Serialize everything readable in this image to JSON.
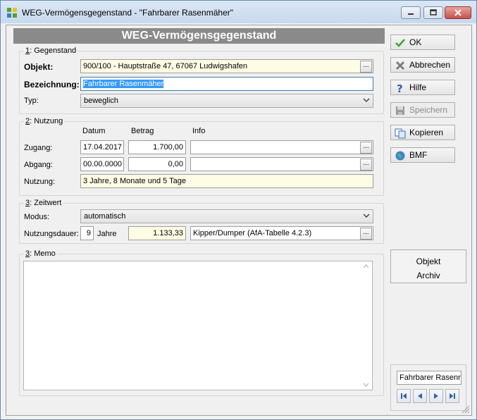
{
  "window": {
    "title": "WEG-Vermögensgegenstand - \"Fahrbarer Rasenmäher\""
  },
  "header": {
    "title": "WEG-Vermögensgegenstand"
  },
  "gegenstand": {
    "legend_num": "1",
    "legend_text": ": Gegenstand",
    "objekt_label": "Objekt:",
    "objekt_value": "900/100 - Hauptstraße 47, 67067 Ludwigshafen",
    "bezeichnung_label": "Bezeichnung:",
    "bezeichnung_value": "Fahrbarer Rasenmäher",
    "typ_label": "Typ:",
    "typ_value": "beweglich"
  },
  "nutzung": {
    "legend_num": "2",
    "legend_text": ": Nutzung",
    "col_datum": "Datum",
    "col_betrag": "Betrag",
    "col_info": "Info",
    "zugang_label": "Zugang:",
    "zugang_datum": "17.04.2017",
    "zugang_betrag": "1.700,00",
    "zugang_info": "",
    "abgang_label": "Abgang:",
    "abgang_datum": "00.00.0000",
    "abgang_betrag": "0,00",
    "abgang_info": "",
    "nutzung_label": "Nutzung:",
    "nutzung_value": "3 Jahre, 8 Monate und 5 Tage"
  },
  "zeitwert": {
    "legend_num": "3",
    "legend_text": ": Zeitwert",
    "modus_label": "Modus:",
    "modus_value": "automatisch",
    "dauer_label": "Nutzungsdauer:",
    "dauer_value": "9",
    "jahre_label": "Jahre",
    "zeitwert_value": "1.133,33",
    "afa_value": "Kipper/Dumper (AfA-Tabelle 4.2.3)"
  },
  "memo": {
    "legend_num": "3",
    "legend_text": ": Memo",
    "value": ""
  },
  "buttons": {
    "ok": "OK",
    "abbrechen": "Abbrechen",
    "hilfe": "Hilfe",
    "speichern": "Speichern",
    "kopieren": "Kopieren",
    "bmf": "BMF",
    "objekt": "Objekt",
    "archiv": "Archiv"
  },
  "navigator": {
    "value": "Fahrbarer Rasenmäher"
  },
  "colors": {
    "header_bg": "#8a8a8a",
    "readonly_yellow": "#fefce4",
    "selection": "#3399ff"
  }
}
